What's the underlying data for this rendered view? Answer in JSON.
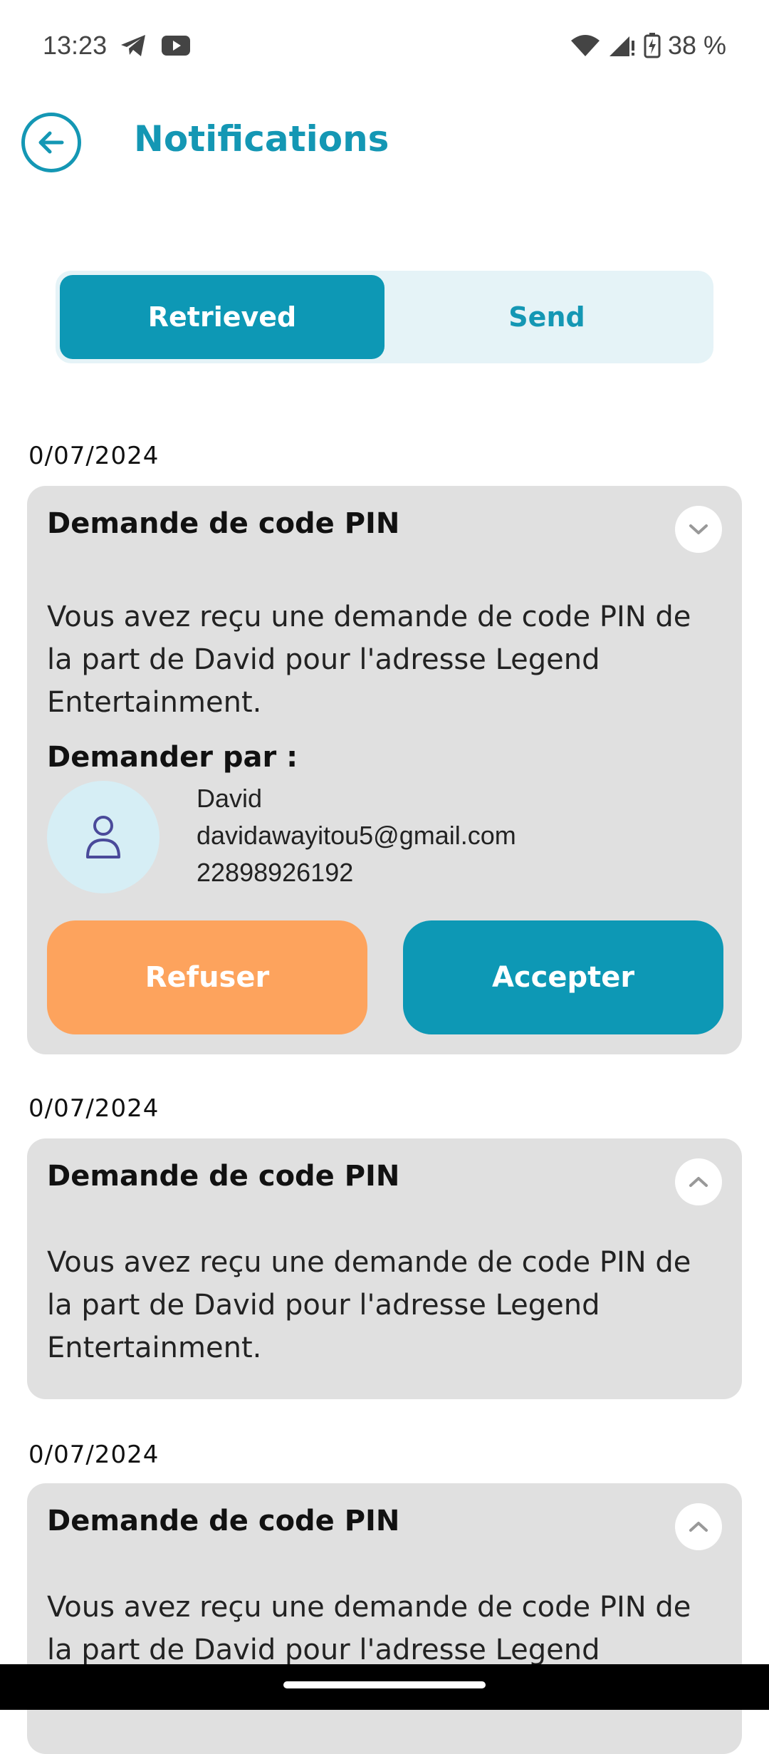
{
  "status_bar": {
    "time": "13:23",
    "battery": "38 %",
    "left_icons": [
      "telegram-icon",
      "youtube-icon"
    ],
    "right_icons": [
      "wifi-icon",
      "signal-icon",
      "battery-charging-icon"
    ]
  },
  "header": {
    "title": "Notifications",
    "back_icon": "arrow-left-icon"
  },
  "tabs": [
    {
      "label": "Retrieved",
      "active": true
    },
    {
      "label": "Send",
      "active": false
    }
  ],
  "notifications": [
    {
      "date": "0/07/2024",
      "title": "Demande de code PIN",
      "expanded": true,
      "message": "Vous avez reçu une demande de code PIN de la part de David pour l'adresse Legend Entertainment.",
      "requested_by_label": "Demander par :",
      "requester": {
        "name": "David",
        "email": "davidawayitou5@gmail.com",
        "phone": "22898926192"
      },
      "refuse_label": "Refuser",
      "accept_label": "Accepter"
    },
    {
      "date": "0/07/2024",
      "title": "Demande de code PIN",
      "expanded": false,
      "message": "Vous avez reçu une demande de code PIN de la part de David pour l'adresse Legend Entertainment."
    },
    {
      "date": "0/07/2024",
      "title": "Demande de code PIN",
      "expanded": false,
      "message": "Vous avez reçu une demande de code PIN de la part de David pour l'adresse Legend Entertainment."
    }
  ],
  "colors": {
    "primary": "#0d98b5",
    "accent_orange": "#fda35d",
    "card_bg": "#e0e0e0",
    "tab_bg": "#e5f3f7"
  }
}
